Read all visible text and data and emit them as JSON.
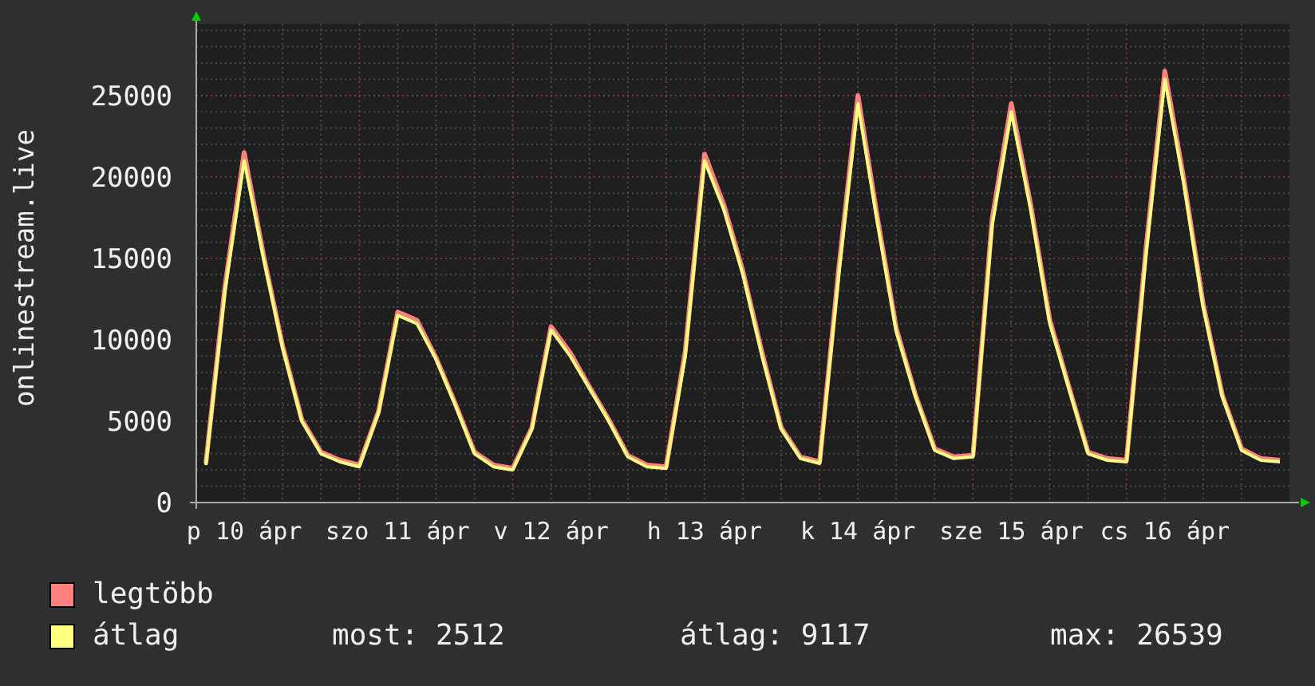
{
  "chart": {
    "chart_data": {
      "type": "line",
      "ylabel": "onlinestream.live",
      "categories": [
        null,
        null,
        "p 10 ápr",
        null,
        null,
        null,
        null,
        null,
        null,
        null,
        "szo 11 ápr",
        null,
        null,
        null,
        null,
        null,
        null,
        null,
        "v 12 ápr",
        null,
        null,
        null,
        null,
        null,
        null,
        null,
        "h 13 ápr",
        null,
        null,
        null,
        null,
        null,
        null,
        null,
        "k 14 ápr",
        null,
        null,
        null,
        null,
        null,
        null,
        null,
        "sze 15 ápr",
        null,
        null,
        null,
        null,
        null,
        null,
        null,
        "cs 16 ápr",
        null,
        null,
        null,
        null,
        null,
        null
      ],
      "series": [
        {
          "name": "legtöbb",
          "color": "#ff8080",
          "values": [
            2400,
            13300,
            21500,
            15200,
            9600,
            5100,
            3100,
            2600,
            2300,
            5600,
            11700,
            11200,
            8900,
            6100,
            3100,
            2300,
            2100,
            4600,
            10800,
            9200,
            7100,
            5100,
            2900,
            2300,
            2200,
            9300,
            21400,
            18300,
            14200,
            9200,
            4600,
            2800,
            2500,
            14400,
            25000,
            17600,
            10700,
            6600,
            3300,
            2800,
            2900,
            17400,
            24500,
            18300,
            11200,
            7100,
            3100,
            2700,
            2600,
            15400,
            26500,
            19800,
            12200,
            6600,
            3300,
            2700,
            2600
          ]
        },
        {
          "name": "átlag",
          "color": "#ffff80",
          "values": [
            2300,
            13000,
            21000,
            15000,
            9500,
            5000,
            3000,
            2500,
            2200,
            5500,
            11500,
            11000,
            8800,
            6000,
            3000,
            2200,
            2000,
            4500,
            10600,
            9000,
            7000,
            5000,
            2800,
            2200,
            2100,
            9000,
            21000,
            18000,
            14000,
            9000,
            4500,
            2700,
            2400,
            14000,
            24500,
            17300,
            10500,
            6500,
            3200,
            2700,
            2800,
            17000,
            24000,
            18000,
            11000,
            7000,
            3000,
            2600,
            2500,
            15000,
            26000,
            19500,
            12000,
            6500,
            3200,
            2600,
            2500
          ]
        }
      ],
      "ylim": [
        0,
        29400
      ],
      "grid": true,
      "yticks": [
        0,
        5000,
        10000,
        15000,
        20000,
        25000
      ]
    }
  },
  "legend": {
    "stats": [
      "most: 2512",
      "átlag: 9117",
      "max: 26539"
    ]
  }
}
